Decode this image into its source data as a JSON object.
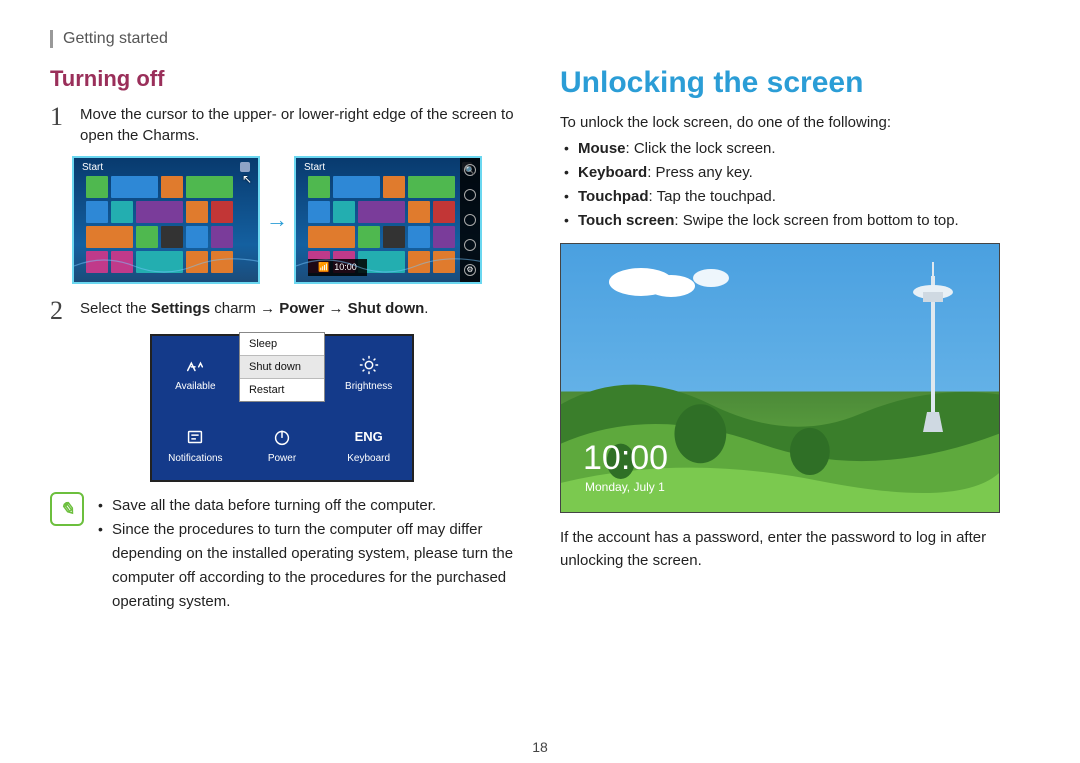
{
  "header": {
    "breadcrumb": "Getting started"
  },
  "page_number": "18",
  "left": {
    "subheading": "Turning off",
    "step1_num": "1",
    "step1_text": "Move the cursor to the upper- or lower-right edge of the screen to open the Charms.",
    "fig1": {
      "start_label_a": "Start",
      "start_label_b": "Start",
      "time_label": "10:00"
    },
    "step2_num": "2",
    "step2_pre": "Select the ",
    "step2_b1": "Settings",
    "step2_mid1": " charm → ",
    "step2_b2": "Power",
    "step2_mid2": " → ",
    "step2_b3": "Shut down",
    "step2_post": ".",
    "fig2": {
      "menu_sleep": "Sleep",
      "menu_shutdown": "Shut down",
      "menu_restart": "Restart",
      "cell_available": "Available",
      "cell_brightness": "Brightness",
      "cell_notifications": "Notifications",
      "cell_power": "Power",
      "cell_keyboard": "Keyboard",
      "eng": "ENG"
    },
    "note1": "Save all the data before turning off the computer.",
    "note2": "Since the procedures to turn the computer off may differ depending on the installed operating system, please turn the computer off according to the procedures for the purchased operating system."
  },
  "right": {
    "heading": "Unlocking the screen",
    "intro": "To unlock the lock screen, do one of the following:",
    "b_mouse_label": "Mouse",
    "b_mouse_rest": ": Click the lock screen.",
    "b_kb_label": "Keyboard",
    "b_kb_rest": ": Press any key.",
    "b_tp_label": "Touchpad",
    "b_tp_rest": ": Tap the touchpad.",
    "b_ts_label": "Touch screen",
    "b_ts_rest": ": Swipe the lock screen from bottom to top.",
    "lock": {
      "time": "10:00",
      "date": "Monday, July 1"
    },
    "outro": "If the account has a password, enter the password to log in after unlocking the screen."
  }
}
